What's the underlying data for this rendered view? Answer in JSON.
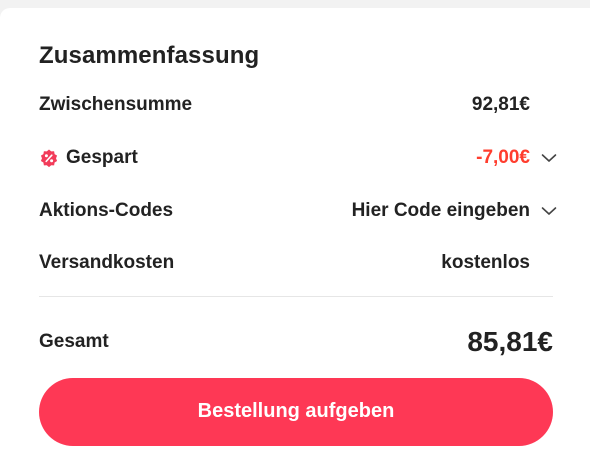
{
  "summary": {
    "title": "Zusammenfassung",
    "subtotal_label": "Zwischensumme",
    "subtotal_value": "92,81€",
    "saved_label": "Gespart",
    "saved_value": "-7,00€",
    "promo_label": "Aktions-Codes",
    "promo_value": "Hier Code eingeben",
    "shipping_label": "Versandkosten",
    "shipping_value": "kostenlos",
    "total_label": "Gesamt",
    "total_value": "85,81€"
  },
  "actions": {
    "place_order_label": "Bestellung aufgeben"
  },
  "icons": {
    "discount": "discount-badge-icon",
    "expand": "chevron-down-icon"
  },
  "colors": {
    "accent": "#fe3855",
    "discount_text": "#ff3d2e",
    "text": "#222222"
  }
}
